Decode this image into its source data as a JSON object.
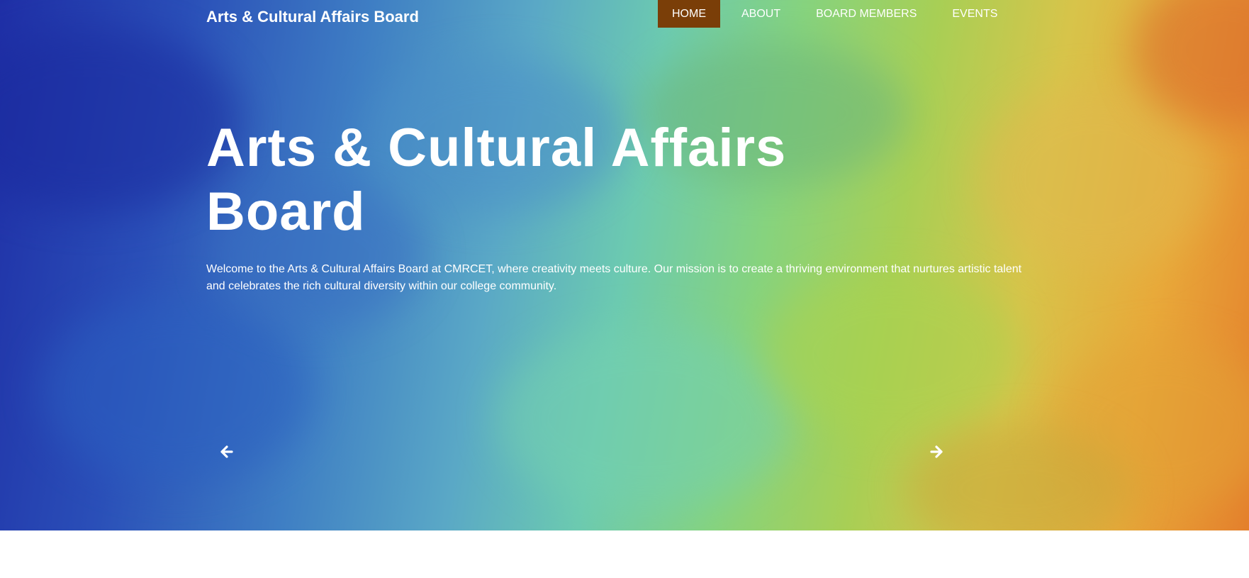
{
  "brand": {
    "title": "Arts & Cultural Affairs Board"
  },
  "nav": {
    "items": [
      {
        "label": "HOME",
        "active": true
      },
      {
        "label": "ABOUT",
        "active": false
      },
      {
        "label": "BOARD MEMBERS",
        "active": false
      },
      {
        "label": "EVENTS",
        "active": false
      }
    ]
  },
  "hero": {
    "title_line1": "Arts & Cultural Affairs",
    "title_line2": "Board",
    "description": "Welcome to the Arts & Cultural Affairs Board at CMRCET, where creativity meets culture. Our mission is to create a thriving environment that nurtures artistic talent and celebrates the rich cultural diversity within our college community.",
    "prev_icon": "arrow-left-icon",
    "next_icon": "arrow-right-icon"
  },
  "colors": {
    "nav_active_bg": "#7a3e08",
    "text": "#ffffff"
  }
}
